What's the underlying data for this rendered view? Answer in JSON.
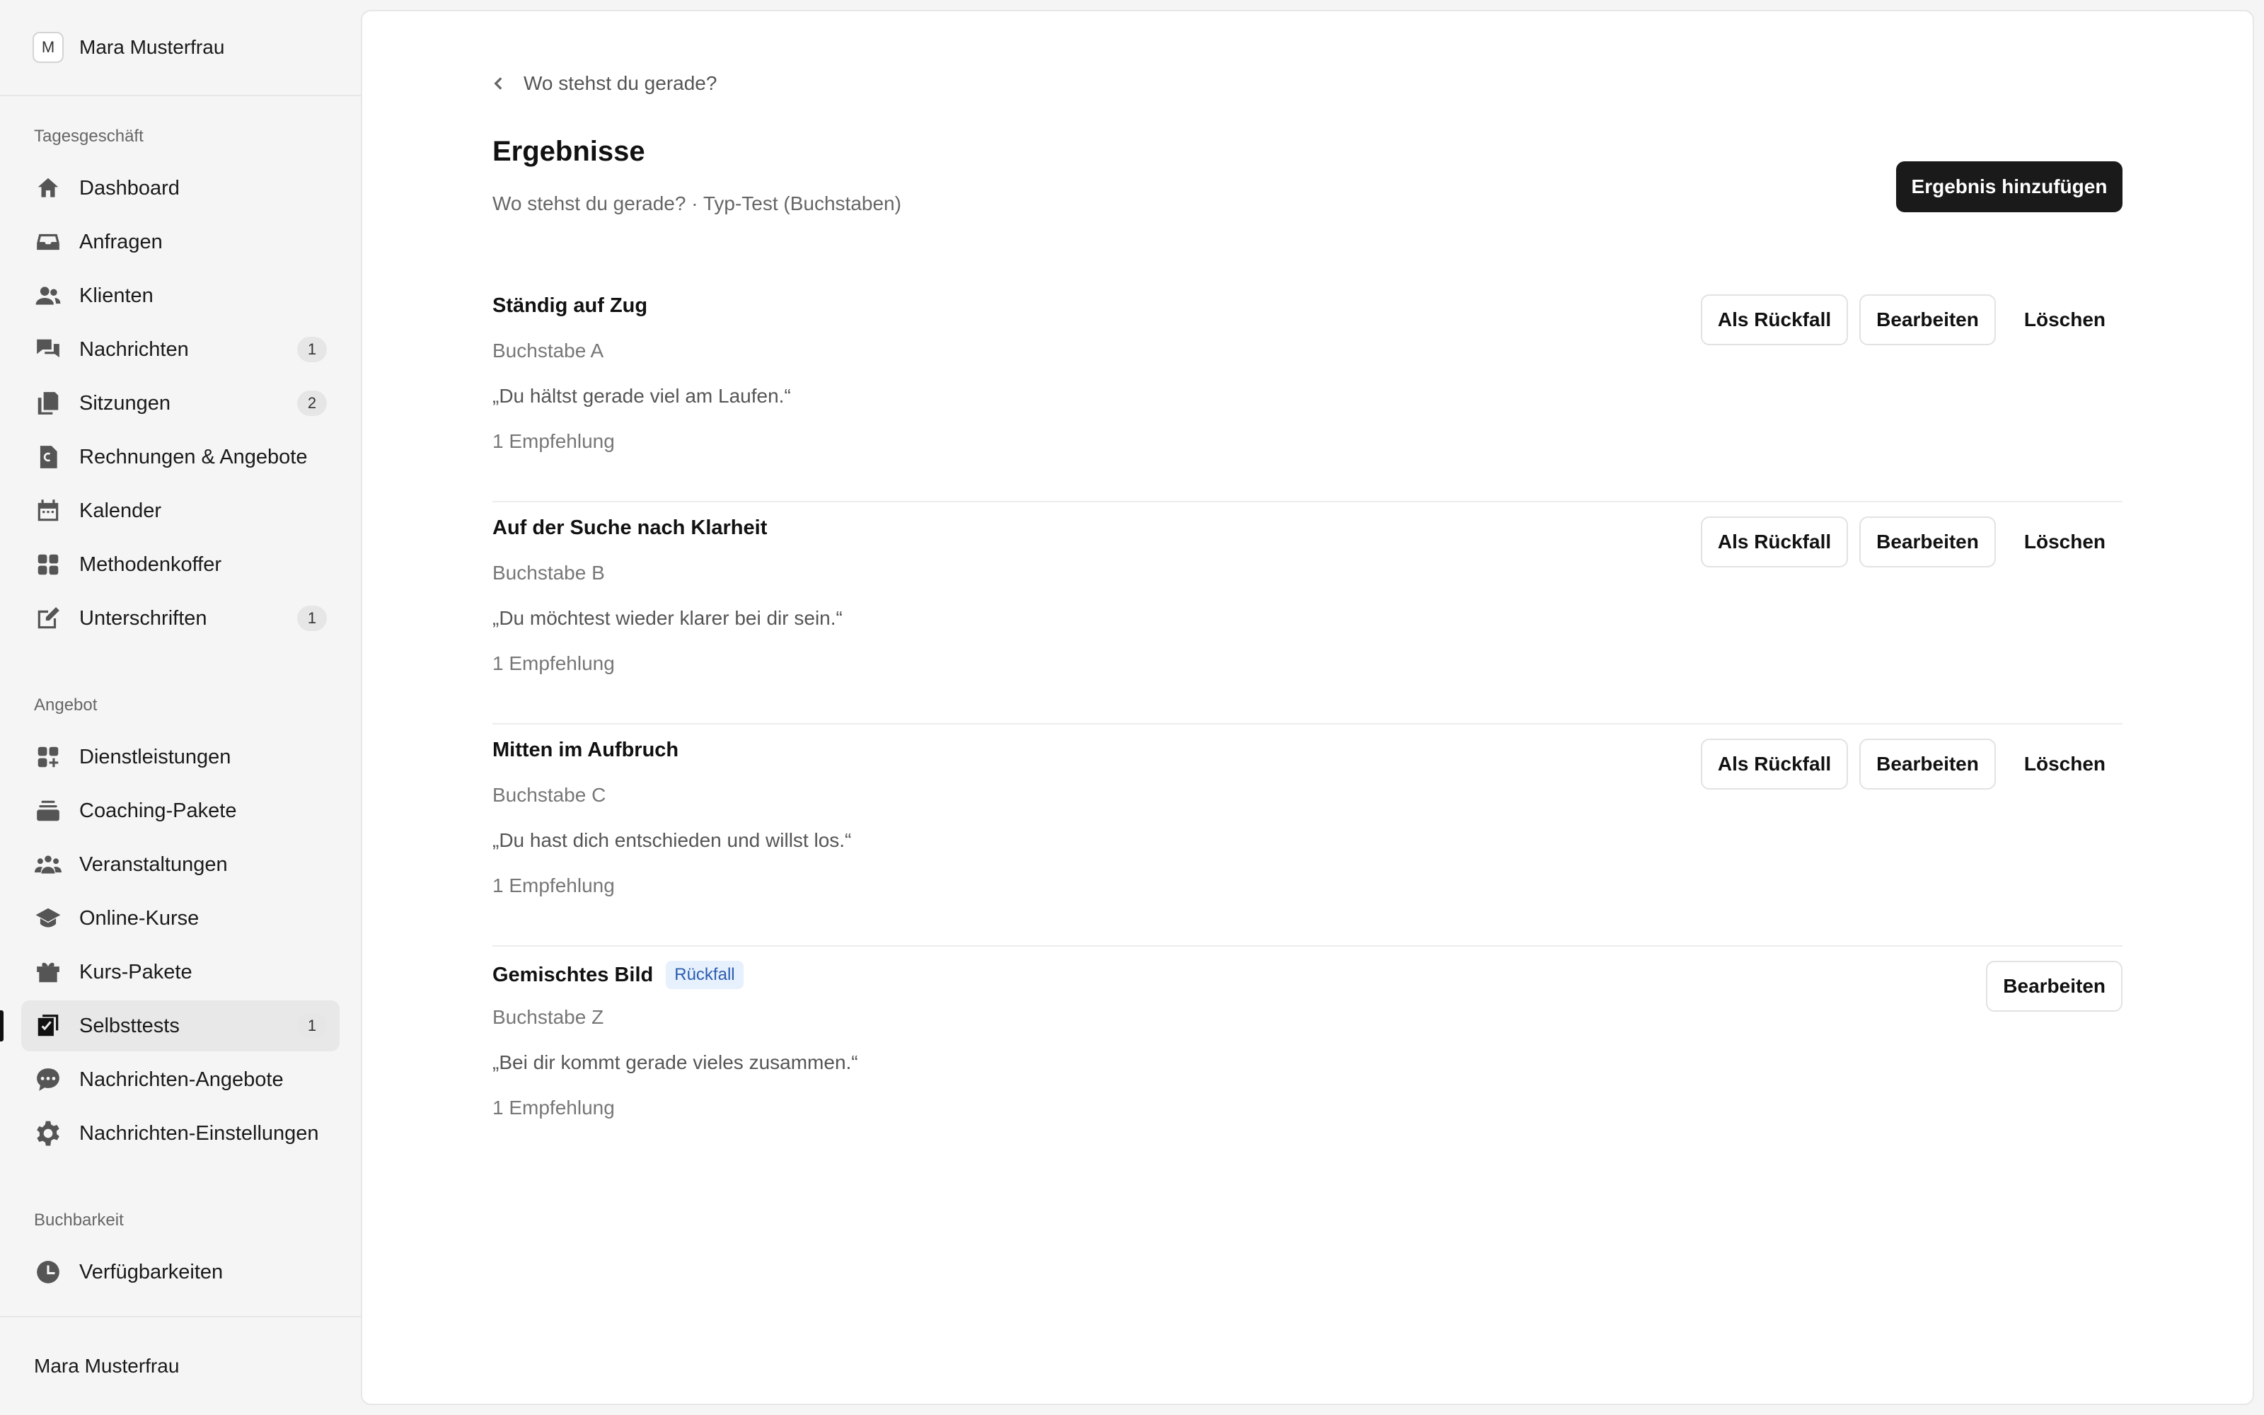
{
  "sidebar": {
    "avatar_initial": "M",
    "user_name": "Mara Musterfrau",
    "sections": [
      {
        "label": "Tagesgeschäft",
        "items": [
          {
            "label": "Dashboard",
            "icon": "home-icon",
            "count": ""
          },
          {
            "label": "Anfragen",
            "icon": "inbox-icon",
            "count": ""
          },
          {
            "label": "Klienten",
            "icon": "users-icon",
            "count": ""
          },
          {
            "label": "Nachrichten",
            "icon": "chat-bubbles-icon",
            "count": "1"
          },
          {
            "label": "Sitzungen",
            "icon": "documents-icon",
            "count": "2"
          },
          {
            "label": "Rechnungen & Angebote",
            "icon": "euro-document-icon",
            "count": ""
          },
          {
            "label": "Kalender",
            "icon": "calendar-icon",
            "count": ""
          },
          {
            "label": "Methodenkoffer",
            "icon": "grid-icon",
            "count": ""
          },
          {
            "label": "Unterschriften",
            "icon": "pencil-square-icon",
            "count": "1"
          }
        ]
      },
      {
        "label": "Angebot",
        "items": [
          {
            "label": "Dienstleistungen",
            "icon": "grid-plus-icon",
            "count": ""
          },
          {
            "label": "Coaching-Pakete",
            "icon": "stack-icon",
            "count": ""
          },
          {
            "label": "Veranstaltungen",
            "icon": "group-icon",
            "count": ""
          },
          {
            "label": "Online-Kurse",
            "icon": "graduation-cap-icon",
            "count": ""
          },
          {
            "label": "Kurs-Pakete",
            "icon": "gift-icon",
            "count": ""
          },
          {
            "label": "Selbsttests",
            "icon": "checkbox-icon",
            "count": "1",
            "active": true
          },
          {
            "label": "Nachrichten-Angebote",
            "icon": "chat-dots-icon",
            "count": ""
          },
          {
            "label": "Nachrichten-Einstellungen",
            "icon": "gear-icon",
            "count": ""
          }
        ]
      },
      {
        "label": "Buchbarkeit",
        "items": [
          {
            "label": "Verfügbarkeiten",
            "icon": "clock-icon",
            "count": ""
          }
        ]
      }
    ],
    "footer_name": "Mara Musterfrau"
  },
  "main": {
    "breadcrumb": "Wo stehst du gerade?",
    "title": "Ergebnisse",
    "subtitle": "Wo stehst du gerade? · Typ-Test (Buchstaben)",
    "add_button": "Ergebnis hinzufügen",
    "actions": {
      "fallback": "Als Rückfall",
      "edit": "Bearbeiten",
      "delete": "Löschen"
    },
    "results": [
      {
        "title": "Ständig auf Zug",
        "letter": "Buchstabe A",
        "quote": "„Du hältst gerade viel am Laufen.“",
        "recommendations": "1 Empfehlung",
        "badge": ""
      },
      {
        "title": "Auf der Suche nach Klarheit",
        "letter": "Buchstabe B",
        "quote": "„Du möchtest wieder klarer bei dir sein.“",
        "recommendations": "1 Empfehlung",
        "badge": ""
      },
      {
        "title": "Mitten im Aufbruch",
        "letter": "Buchstabe C",
        "quote": "„Du hast dich entschieden und willst los.“",
        "recommendations": "1 Empfehlung",
        "badge": ""
      },
      {
        "title": "Gemischtes Bild",
        "letter": "Buchstabe Z",
        "quote": "„Bei dir kommt gerade vieles zusammen.“",
        "recommendations": "1 Empfehlung",
        "badge": "Rückfall"
      }
    ]
  },
  "colors": {
    "primary_button": "#1a1a1a",
    "badge_bg": "#e7f0fd",
    "badge_text": "#2a5db0",
    "active_nav": "#e8e8e8"
  }
}
